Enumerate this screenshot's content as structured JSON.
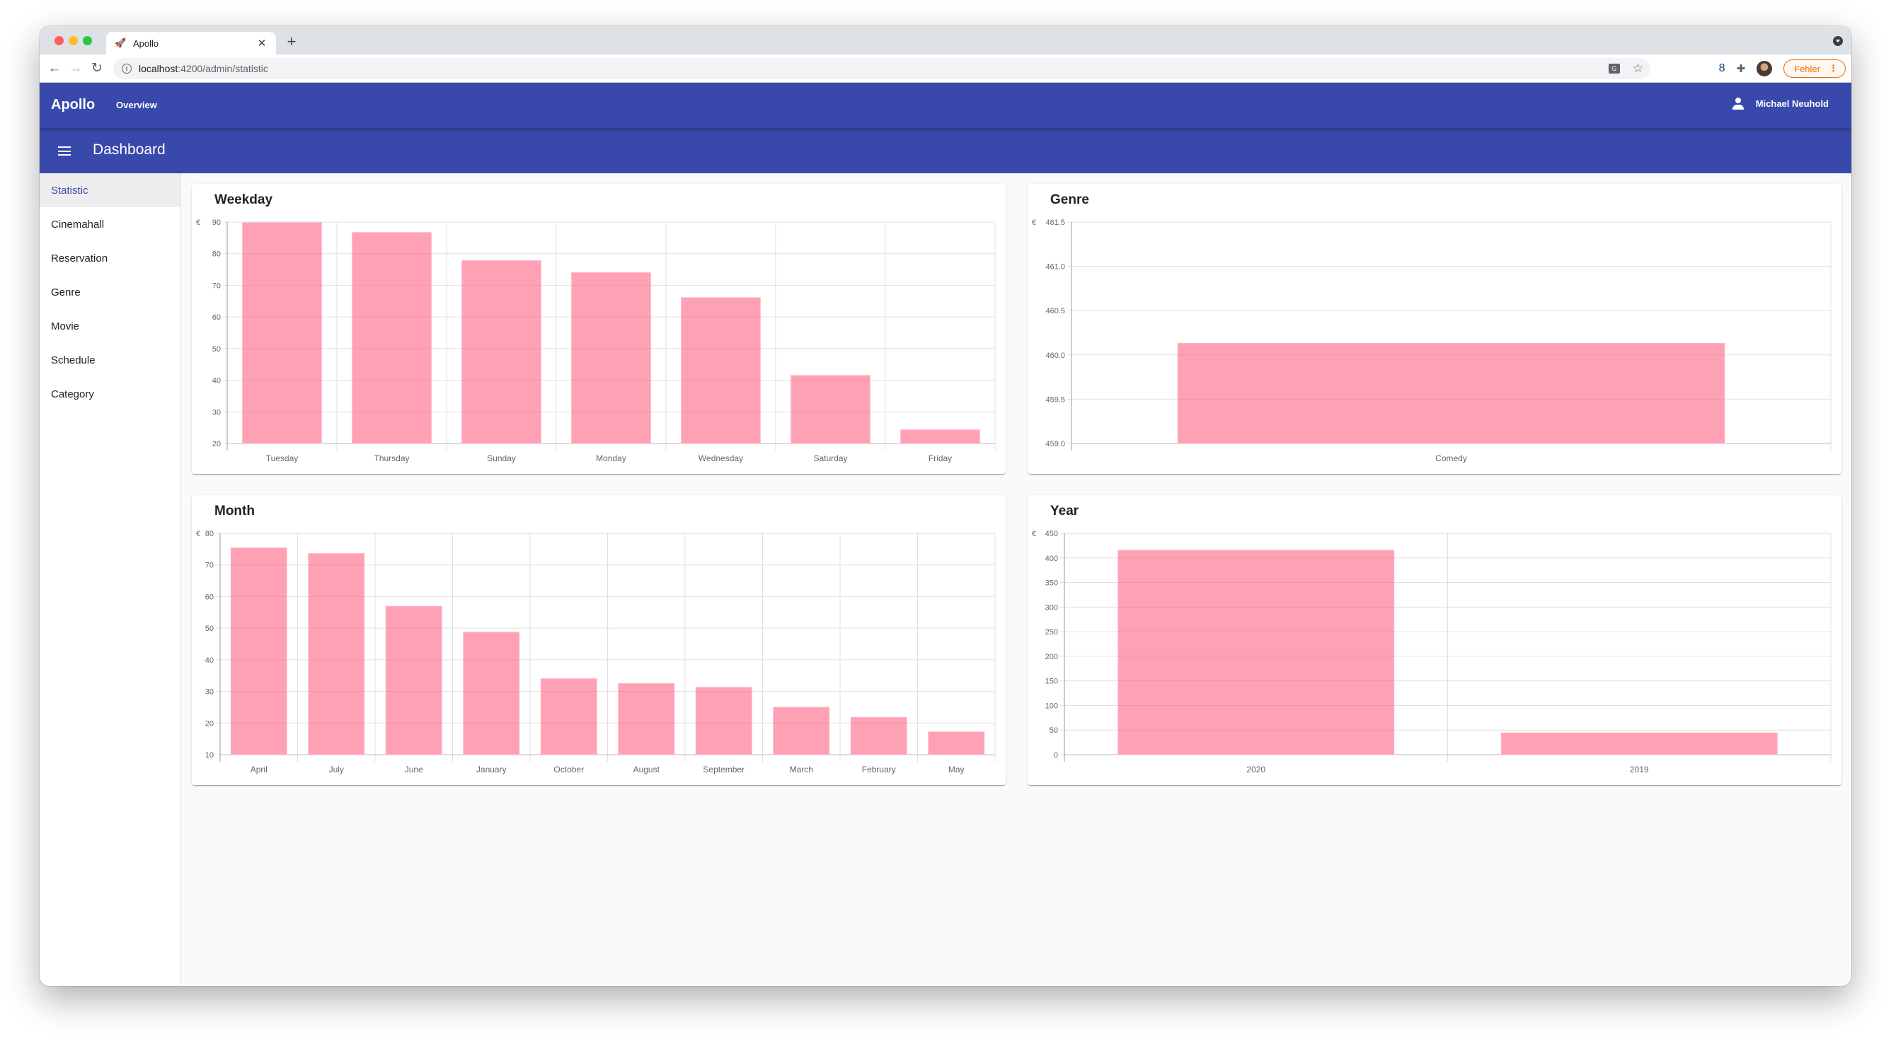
{
  "browser": {
    "tab_title": "Apollo",
    "tab_favicon": "rocket-icon",
    "url_host": "localhost",
    "url_path": ":4200/admin/statistic",
    "error_chip_label": "Fehler",
    "icons": [
      "back-arrow-icon",
      "forward-arrow-icon",
      "reload-icon",
      "info-icon",
      "translate-icon",
      "star-icon",
      "extension-icon",
      "puzzle-icon",
      "profile-avatar",
      "kebab-menu-icon"
    ]
  },
  "appbar": {
    "brand": "Apollo",
    "nav_overview": "Overview",
    "user_name": "Michael Neuhold"
  },
  "subbar": {
    "title": "Dashboard"
  },
  "sidebar": {
    "items": [
      {
        "label": "Statistic",
        "active": true
      },
      {
        "label": "Cinemahall",
        "active": false
      },
      {
        "label": "Reservation",
        "active": false
      },
      {
        "label": "Genre",
        "active": false
      },
      {
        "label": "Movie",
        "active": false
      },
      {
        "label": "Schedule",
        "active": false
      },
      {
        "label": "Category",
        "active": false
      }
    ]
  },
  "colors": {
    "primary": "#3949ab",
    "bar_fill": "#ff6384",
    "bar_fill_opacity": 0.6,
    "active_nav_text": "#3949ab",
    "error_chip": "#e8710a"
  },
  "chart_data": [
    {
      "id": "weekday",
      "type": "bar",
      "title": "Weekday",
      "ylabel": "€",
      "xlabel": "",
      "categories": [
        "Tuesday",
        "Thursday",
        "Sunday",
        "Monday",
        "Wednesday",
        "Saturday",
        "Friday"
      ],
      "values": [
        89.8,
        86.7,
        77.8,
        74.0,
        66.1,
        41.5,
        24.3
      ],
      "ylim": [
        20,
        90
      ],
      "yticks": [
        20,
        30,
        40,
        50,
        60,
        70,
        80,
        90
      ],
      "grid": true,
      "legend": "none"
    },
    {
      "id": "genre",
      "type": "bar",
      "title": "Genre",
      "ylabel": "€",
      "xlabel": "",
      "categories": [
        "Comedy"
      ],
      "values": [
        460.13
      ],
      "ylim": [
        459.0,
        461.5
      ],
      "yticks": [
        "459.0",
        "459.5",
        "460.0",
        "460.5",
        "461.0",
        "461.5"
      ],
      "grid": true,
      "legend": "none"
    },
    {
      "id": "month",
      "type": "bar",
      "title": "Month",
      "ylabel": "€",
      "xlabel": "",
      "categories": [
        "April",
        "July",
        "June",
        "January",
        "October",
        "August",
        "September",
        "March",
        "February",
        "May"
      ],
      "values": [
        75.4,
        73.6,
        56.9,
        48.7,
        34.0,
        32.5,
        31.3,
        25.0,
        21.8,
        17.2
      ],
      "ylim": [
        10,
        80
      ],
      "yticks": [
        10,
        20,
        30,
        40,
        50,
        60,
        70,
        80
      ],
      "grid": true,
      "legend": "none"
    },
    {
      "id": "year",
      "type": "bar",
      "title": "Year",
      "ylabel": "€",
      "xlabel": "",
      "categories": [
        "2020",
        "2019"
      ],
      "values": [
        415.4,
        44.2
      ],
      "ylim": [
        0,
        450
      ],
      "yticks": [
        0,
        50,
        100,
        150,
        200,
        250,
        300,
        350,
        400,
        450
      ],
      "grid": true,
      "legend": "none"
    }
  ]
}
